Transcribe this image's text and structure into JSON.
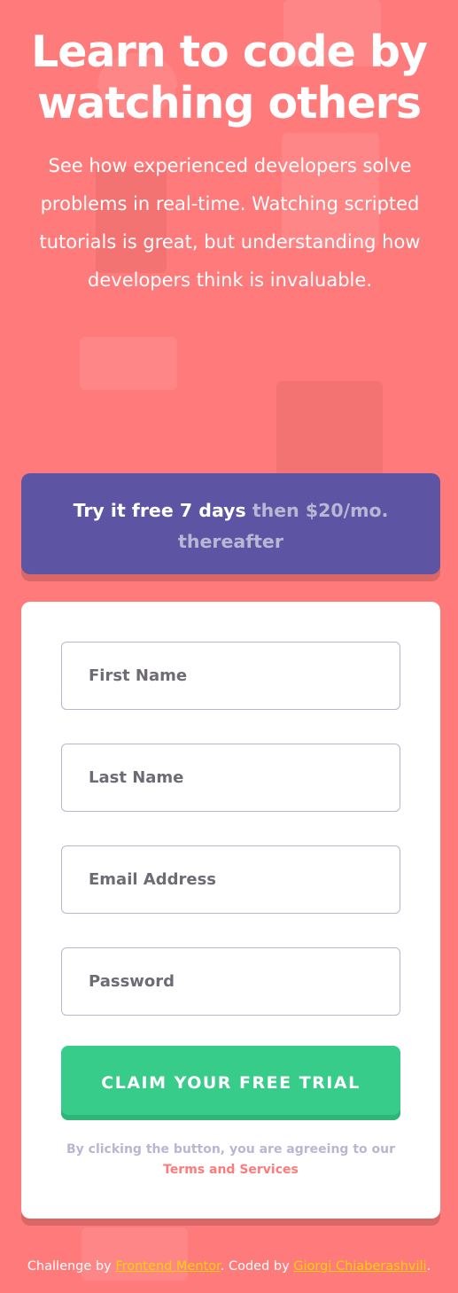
{
  "hero": {
    "title": "Learn to code by watching others",
    "description": "See how experienced developers solve problems in real-time. Watching scripted tutorials is great, but understanding how developers think is invaluable."
  },
  "offer": {
    "highlight": "Try it free 7 days",
    "rest": "then $20/mo. thereafter"
  },
  "form": {
    "first_name_placeholder": "First Name",
    "last_name_placeholder": "Last Name",
    "email_placeholder": "Email Address",
    "password_placeholder": "Password",
    "submit_label": "CLAIM YOUR FREE TRIAL",
    "terms_prefix": "By clicking the button, you are agreeing to our",
    "terms_link": "Terms and Services"
  },
  "footer": {
    "challenge_prefix": "Challenge by",
    "challenge_link": "Frontend Mentor",
    "coded_prefix": ". Coded by",
    "coded_link": "Giorgi Chiaberashvili",
    "suffix": "."
  },
  "colors": {
    "background": "#ff7a7a",
    "offer_bg": "#5e54a4",
    "button_green": "#38cc8b",
    "link_yellow": "#ffd400",
    "terms_link": "#ff7a7a"
  }
}
